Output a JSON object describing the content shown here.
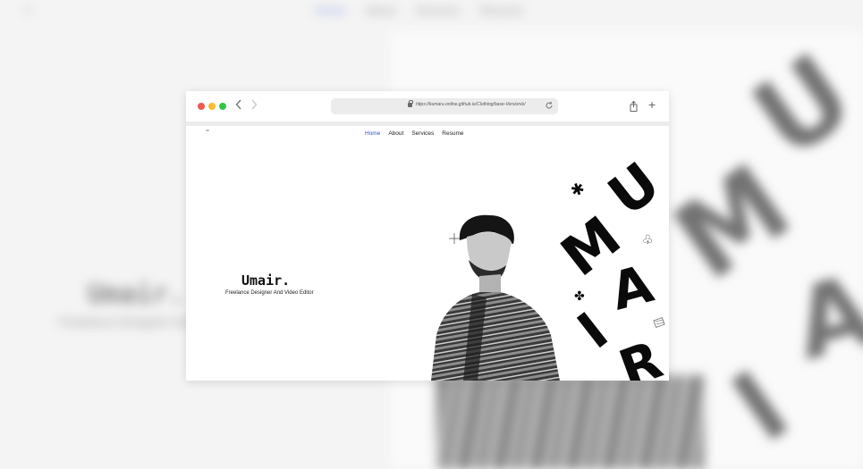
{
  "site": {
    "nav": [
      {
        "label": "Home",
        "active": true
      },
      {
        "label": "About",
        "active": false
      },
      {
        "label": "Services",
        "active": false
      },
      {
        "label": "Resume",
        "active": false
      }
    ],
    "hero": {
      "name": "Umair.",
      "subtitle": "Freelance Designer And Video Editor"
    },
    "art_letters": [
      "U",
      "M",
      "A",
      "I",
      "R"
    ]
  },
  "browser": {
    "url": "https://kumaru.online.github.io/Clothing/base-Version/e/",
    "traffic_colors": [
      "#ee5a52",
      "#f5bd2f",
      "#33c748"
    ]
  },
  "icons": {
    "back": "chevron-left-icon",
    "forward": "chevron-right-icon",
    "lock": "lock-icon",
    "reload": "reload-icon",
    "share": "share-icon",
    "new_tab": "plus-icon"
  },
  "colors": {
    "nav_active": "#2f55d4",
    "text": "#222222",
    "art_black": "#0a0a0a"
  }
}
